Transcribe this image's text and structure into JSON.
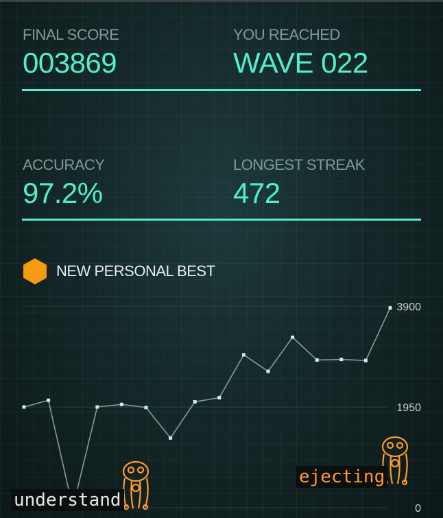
{
  "stats": {
    "final_score": {
      "label": "FINAL SCORE",
      "value": "003869"
    },
    "wave": {
      "label": "YOU REACHED",
      "value": "WAVE 022"
    },
    "accuracy": {
      "label": "ACCURACY",
      "value": "97.2%"
    },
    "streak": {
      "label": "LONGEST STREAK",
      "value": "472"
    }
  },
  "badge": {
    "text": "NEW PERSONAL BEST",
    "icon": "hexagon-icon",
    "color": "#f39c12"
  },
  "colors": {
    "accent": "#4ff0cf",
    "label": "#7e9a98",
    "line": "#8a9a9a",
    "point": "#bff5e6",
    "orange": "#ff9a2e"
  },
  "chart_data": {
    "type": "line",
    "title": "",
    "xlabel": "",
    "ylabel": "",
    "ylim": [
      0,
      3900
    ],
    "y_ticks": [
      "3900",
      "1950",
      "0"
    ],
    "x": [
      1,
      2,
      3,
      4,
      5,
      6,
      7,
      8,
      9,
      10,
      11,
      12,
      13,
      14,
      15,
      16
    ],
    "series": [
      {
        "values": [
          1950,
          2080,
          0,
          1950,
          2000,
          1940,
          1350,
          2050,
          2130,
          2960,
          2640,
          3300,
          2860,
          2870,
          2850,
          3869
        ]
      }
    ]
  },
  "tags": [
    {
      "text": "understand",
      "color": "#e8e8e8"
    },
    {
      "text": "ejecting",
      "color": "#ff9a2e"
    }
  ],
  "creatures": [
    "creature-icon",
    "creature-icon"
  ]
}
